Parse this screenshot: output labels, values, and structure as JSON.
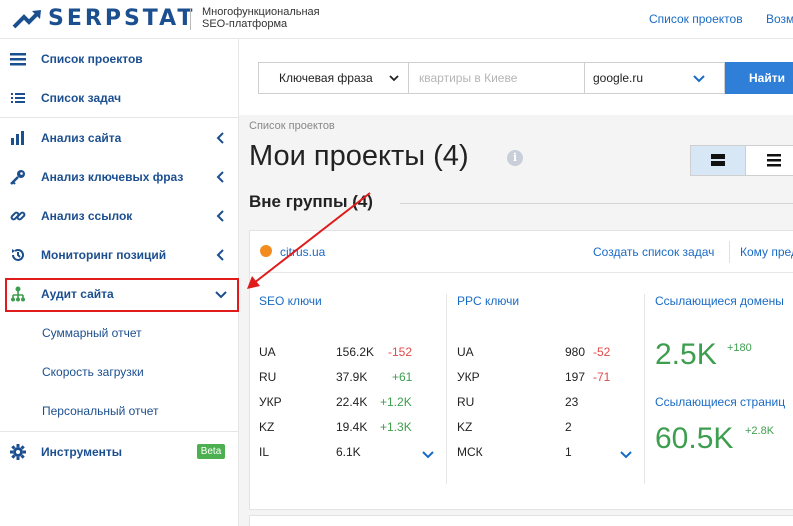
{
  "header": {
    "logo_text": "SERPSTAT",
    "tagline_line1": "Многофункциональная",
    "tagline_line2": "SEO-платформа",
    "nav": [
      "Список проектов",
      "Возм"
    ]
  },
  "sidebar": {
    "items": [
      {
        "label": "Список проектов",
        "icon": "menu-icon"
      },
      {
        "label": "Список задач",
        "icon": "list-icon"
      },
      {
        "label": "Анализ сайта",
        "icon": "bar-chart-icon"
      },
      {
        "label": "Анализ ключевых фраз",
        "icon": "key-icon"
      },
      {
        "label": "Анализ ссылок",
        "icon": "link-icon"
      },
      {
        "label": "Мониторинг позиций",
        "icon": "history-icon"
      },
      {
        "label": "Аудит сайта",
        "icon": "sitemap-icon"
      },
      {
        "label": "Суммарный отчет"
      },
      {
        "label": "Скорость загрузки"
      },
      {
        "label": "Персональный отчет"
      },
      {
        "label": "Инструменты",
        "icon": "gear-icon"
      }
    ],
    "beta_badge": "Beta"
  },
  "search": {
    "type_value": "Ключевая фраза",
    "query_placeholder": "квартиры в Киеве",
    "database_value": "google.ru",
    "submit_label": "Найти"
  },
  "main": {
    "breadcrumb": "Список проектов",
    "title": "Мои проекты (4)",
    "group_title": "Вне группы (4)"
  },
  "project": {
    "site": "citrus.ua",
    "actions": [
      "Создать список задач",
      "Кому пред"
    ],
    "seo": {
      "title": "SEO ключи",
      "rows": [
        {
          "region": "UA",
          "value": "156.2K",
          "delta": "-152",
          "trend": "neg"
        },
        {
          "region": "RU",
          "value": "37.9K",
          "delta": "+61",
          "trend": "pos"
        },
        {
          "region": "УКР",
          "value": "22.4K",
          "delta": "+1.2K",
          "trend": "pos"
        },
        {
          "region": "KZ",
          "value": "19.4K",
          "delta": "+1.3K",
          "trend": "pos"
        },
        {
          "region": "IL",
          "value": "6.1K",
          "delta": "",
          "trend": ""
        }
      ]
    },
    "ppc": {
      "title": "PPC ключи",
      "rows": [
        {
          "region": "UA",
          "value": "980",
          "delta": "-52",
          "trend": "neg"
        },
        {
          "region": "УКР",
          "value": "197",
          "delta": "-71",
          "trend": "neg"
        },
        {
          "region": "RU",
          "value": "23",
          "delta": "",
          "trend": ""
        },
        {
          "region": "KZ",
          "value": "2",
          "delta": "",
          "trend": ""
        },
        {
          "region": "МСК",
          "value": "1",
          "delta": "",
          "trend": ""
        }
      ]
    },
    "ref_domains": {
      "title": "Ссылающиеся домены",
      "value": "2.5K",
      "delta": "+180"
    },
    "ref_pages": {
      "title": "Ссылающиеся страниц",
      "value": "60.5K",
      "delta": "+2.8K"
    }
  },
  "colors": {
    "brand": "#1c4f8f",
    "link": "#1a6bc4",
    "accent": "#2f7ed8",
    "positive": "#3e9e4f",
    "negative": "#e04b4b",
    "highlight": "#e01b1b"
  }
}
